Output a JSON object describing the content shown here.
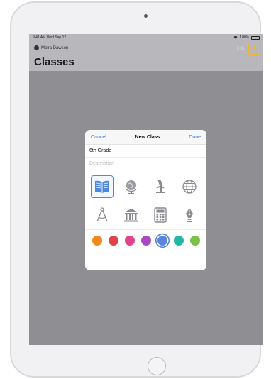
{
  "status_bar": {
    "time_date": "9:41 AM  Wed Sep 12",
    "battery": "100%"
  },
  "nav": {
    "user_name": "Moira Dawson",
    "edit_label": "Edit",
    "add_label": "+",
    "title": "Classes"
  },
  "dialog": {
    "cancel_label": "Cancel",
    "title": "New Class",
    "done_label": "Done",
    "name_value": "6th Grade",
    "description_placeholder": "Description",
    "icons": [
      "book-icon",
      "globe-icon",
      "microscope-icon",
      "world-grid-icon",
      "compass-icon",
      "museum-icon",
      "calculator-icon",
      "pen-nib-icon"
    ],
    "selected_icon": "book-icon",
    "colors": [
      "#f08a1e",
      "#e0434b",
      "#e0448c",
      "#a84bc0",
      "#5b84dc",
      "#25b7a6",
      "#7cc24a"
    ],
    "selected_color": "#5b84dc"
  }
}
